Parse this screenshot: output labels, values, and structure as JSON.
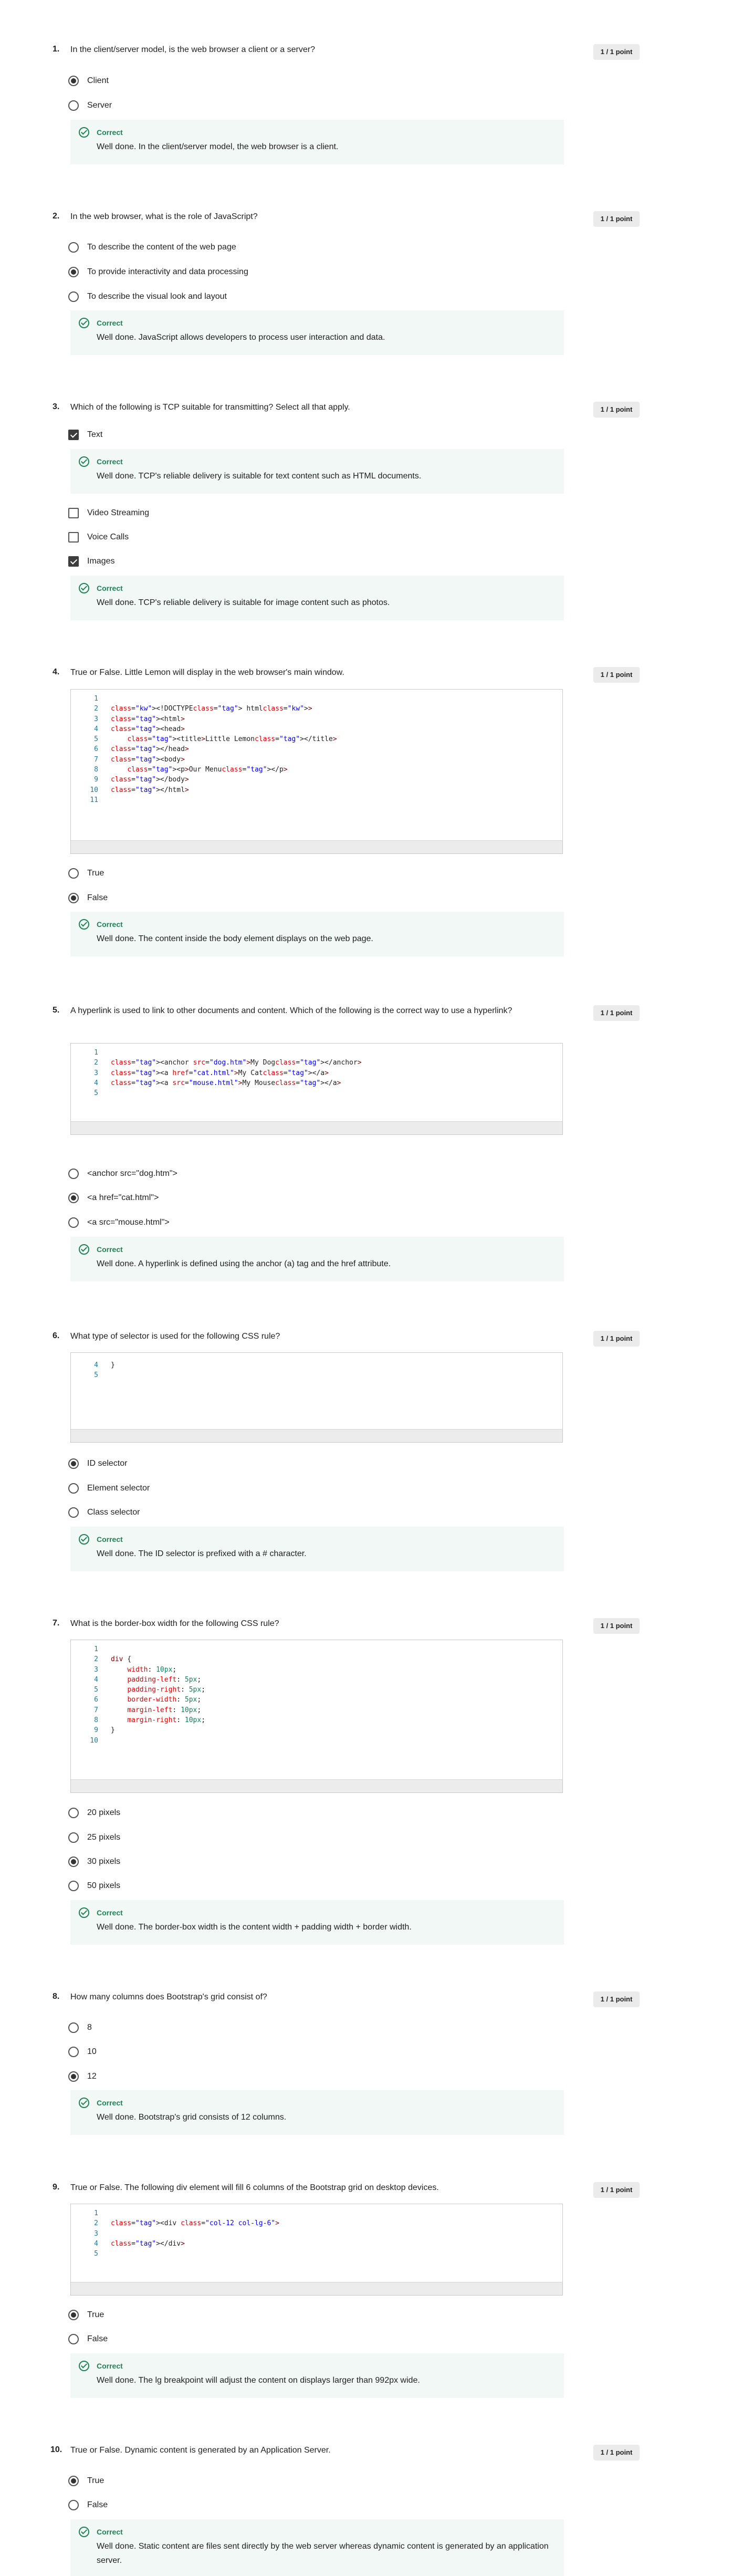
{
  "points_label": "1 / 1 point",
  "feedback_title": "Correct",
  "questions": [
    {
      "num": "1.",
      "text": "In the client/server model, is the web browser a client or a server?",
      "options": [
        "Client",
        "Server"
      ],
      "feedback": "Well done. In the client/server model, the web browser is a client."
    },
    {
      "num": "2.",
      "text": "In the web browser, what is the role of JavaScript?",
      "options": [
        "To describe the content of the web page",
        "To provide interactivity and data processing",
        "To describe the visual look and layout"
      ],
      "feedback": "Well done. JavaScript allows developers to process user interaction and data."
    },
    {
      "num": "3.",
      "text": "Which of the following is TCP suitable for transmitting? Select all that apply.",
      "options": [
        "Text",
        "Video Streaming",
        "Voice Calls",
        "Images"
      ],
      "feedback_text": "Well done. TCP's reliable delivery is suitable for text content such as HTML documents.",
      "feedback_images": "Well done. TCP's reliable delivery is suitable for image content such as photos."
    },
    {
      "num": "4.",
      "text": "True or False. Little Lemon will display in the web browser's main window.",
      "code": [
        "",
        "<!DOCTYPE html>",
        "<html>",
        "<head>",
        "    <title>Little Lemon</title>",
        "</head>",
        "<body>",
        "    <p>Our Menu</p>",
        "</body>",
        "</html>",
        ""
      ],
      "options": [
        "True",
        "False"
      ],
      "feedback": "Well done. The content inside the body element displays on the web page."
    },
    {
      "num": "5.",
      "text": "A hyperlink is used to link to other documents and content. Which of the following is the correct way to use a hyperlink?",
      "code": [
        "",
        "<anchor src=\"dog.htm\">My Dog</anchor>",
        "<a href=\"cat.html\">My Cat</a>",
        "<a src=\"mouse.html\">My Mouse</a>",
        ""
      ],
      "options": [
        "<anchor src=\"dog.htm\">",
        "<a href=\"cat.html\">",
        "<a src=\"mouse.html\">"
      ],
      "feedback": "Well done. A hyperlink is defined using the anchor (a) tag and the href attribute."
    },
    {
      "num": "6.",
      "text": "What type of selector is used for the following CSS rule?",
      "code": [
        "}",
        ""
      ],
      "code_start": 4,
      "options": [
        "ID selector",
        "Element selector",
        "Class selector"
      ],
      "feedback": "Well done. The ID selector is prefixed with a # character."
    },
    {
      "num": "7.",
      "text": "What is the border-box width for the following CSS rule?",
      "code": [
        "",
        "div {",
        "    width: 10px;",
        "    padding-left: 5px;",
        "    padding-right: 5px;",
        "    border-width: 5px;",
        "    margin-left: 10px;",
        "    margin-right: 10px;",
        "}",
        ""
      ],
      "options": [
        "20 pixels",
        "25 pixels",
        "30 pixels",
        "50 pixels"
      ],
      "feedback": "Well done. The border-box width is the content width + padding width + border width."
    },
    {
      "num": "8.",
      "text": "How many columns does Bootstrap's grid consist of?",
      "options": [
        "8",
        "10",
        "12"
      ],
      "feedback": "Well done. Bootstrap's grid consists of 12 columns."
    },
    {
      "num": "9.",
      "text": "True or False. The following div element will fill 6 columns of the Bootstrap grid on desktop devices.",
      "code": [
        "",
        "<div class=\"col-12 col-lg-6\">",
        "",
        "</div>",
        ""
      ],
      "options": [
        "True",
        "False"
      ],
      "feedback": "Well done. The lg breakpoint will adjust the content on displays larger than 992px wide."
    },
    {
      "num": "10.",
      "text": "True or False. Dynamic content is generated by an Application Server.",
      "options": [
        "True",
        "False"
      ],
      "feedback": "Well done. Static content are files sent directly by the web server whereas dynamic content is generated by an application server."
    }
  ]
}
